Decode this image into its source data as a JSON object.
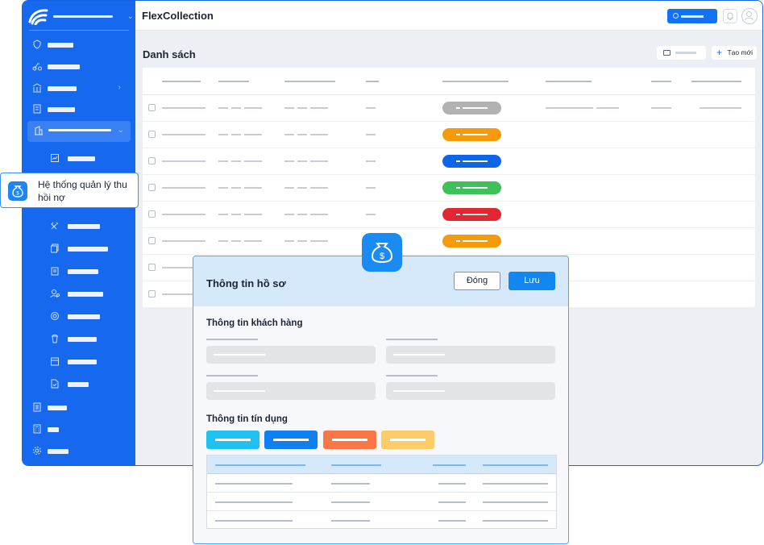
{
  "app": {
    "title": "FlexCollection",
    "list_title": "Danh sách",
    "create_label": "Tạo mới",
    "plus_glyph": "+"
  },
  "sidebar": {
    "float_label": "Hệ thống quản lý thu hồi nợ",
    "items": [
      {
        "icon": "shield-icon"
      },
      {
        "icon": "scooter-icon"
      },
      {
        "icon": "bank-icon",
        "has_chevron": true
      },
      {
        "icon": "calculator-icon"
      },
      {
        "icon": "building-icon",
        "expanded": true
      },
      {
        "icon": "report-icon"
      },
      {
        "icon": "money-bag-icon"
      },
      {
        "icon": "tools-icon"
      },
      {
        "icon": "docs-icon"
      },
      {
        "icon": "clipboard-icon"
      },
      {
        "icon": "user-settings-icon"
      },
      {
        "icon": "target-icon"
      },
      {
        "icon": "trash-icon"
      },
      {
        "icon": "calendar-icon"
      },
      {
        "icon": "file-check-icon"
      },
      {
        "icon": "list-icon"
      },
      {
        "icon": "calculator-icon"
      },
      {
        "icon": "gear-icon"
      }
    ]
  },
  "table": {
    "status_colors": [
      "#b2b2b2",
      "#f59a0b",
      "#0f65e8",
      "#3ec05a",
      "#e22632",
      "#f59a0b",
      "",
      ""
    ]
  },
  "modal": {
    "title": "Thông tin hồ sơ",
    "close_label": "Đóng",
    "save_label": "Lưu",
    "section_customer": "Thông tin khách hàng",
    "section_credit": "Thông tin tín dụng",
    "chip_colors": [
      "#1ec1ef",
      "#0f80f0",
      "#fb7647",
      "#fdcb67"
    ]
  },
  "colors": {
    "sidebar": "#1668ee",
    "accent": "#1287f2"
  }
}
